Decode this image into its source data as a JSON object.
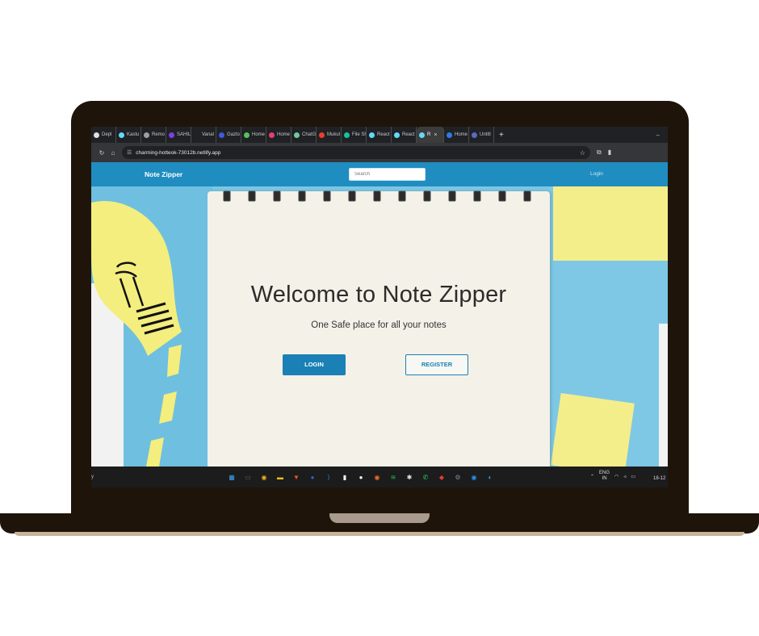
{
  "browser": {
    "tabs": [
      {
        "label": "Depl",
        "color": "#e0e0e0"
      },
      {
        "label": "Kastu",
        "color": "#61dafb"
      },
      {
        "label": "Remo",
        "color": "#9e9e9e"
      },
      {
        "label": "SAHIL",
        "color": "#7b3fe4"
      },
      {
        "label": "Vanal",
        "color": "#222222"
      },
      {
        "label": "Gazto",
        "color": "#3b5bdb"
      },
      {
        "label": "Home",
        "color": "#55c15a"
      },
      {
        "label": "Home",
        "color": "#e53f6c"
      },
      {
        "label": "ChatG",
        "color": "#74c69d"
      },
      {
        "label": "Mukul",
        "color": "#ea3e30"
      },
      {
        "label": "File Sh",
        "color": "#18c29c"
      },
      {
        "label": "React",
        "color": "#61dafb"
      },
      {
        "label": "React",
        "color": "#61dafb"
      },
      {
        "label": "R",
        "color": "#61dafb",
        "active": true
      },
      {
        "label": "Home",
        "color": "#2f7ae5"
      },
      {
        "label": "Untitl",
        "color": "#5c6bc0"
      }
    ],
    "new_tab": "+",
    "minimize": "–",
    "url": "charming-hotteok-73012b.netlify.app"
  },
  "navbar": {
    "brand": "Note Zipper",
    "search_placeholder": "Search",
    "login_link": "Login"
  },
  "hero": {
    "title": "Welcome to Note Zipper",
    "subtitle": "One Safe place for all your notes",
    "login_button": "LOGIN",
    "register_button": "REGISTER"
  },
  "taskbar": {
    "left_text": "y",
    "lang_top": "ENG",
    "lang_bottom": "IN",
    "clock": "18-12",
    "apps": [
      {
        "icon": "windows-start-icon",
        "color": "#3aa0f0",
        "glyph": "▦"
      },
      {
        "icon": "task-view-icon",
        "color": "#6b6b6b",
        "glyph": "▭"
      },
      {
        "icon": "chrome-icon",
        "color": "#e8b024",
        "glyph": "◉"
      },
      {
        "icon": "file-explorer-icon",
        "color": "#f4c020",
        "glyph": "▬"
      },
      {
        "icon": "brave-icon",
        "color": "#f0561d",
        "glyph": "▼"
      },
      {
        "icon": "app-icon",
        "color": "#2c5fd4",
        "glyph": "●"
      },
      {
        "icon": "vscode-icon",
        "color": "#1d8fe0",
        "glyph": "⟩"
      },
      {
        "icon": "app-icon",
        "color": "#ffffff",
        "glyph": "▮"
      },
      {
        "icon": "github-icon",
        "color": "#f5f5f5",
        "glyph": "●"
      },
      {
        "icon": "postman-icon",
        "color": "#ef6c2b",
        "glyph": "◉"
      },
      {
        "icon": "spotify-icon",
        "color": "#1db954",
        "glyph": "≋"
      },
      {
        "icon": "slack-icon",
        "color": "#e8e8e8",
        "glyph": "✱"
      },
      {
        "icon": "whatsapp-icon",
        "color": "#25d366",
        "glyph": "✆"
      },
      {
        "icon": "anydesk-icon",
        "color": "#e53935",
        "glyph": "◆"
      },
      {
        "icon": "settings-icon",
        "color": "#7a8aa0",
        "glyph": "⚙"
      },
      {
        "icon": "app-icon",
        "color": "#2196f3",
        "glyph": "◉"
      },
      {
        "icon": "edge-icon",
        "color": "#2ba5d8",
        "glyph": "◐"
      }
    ]
  }
}
